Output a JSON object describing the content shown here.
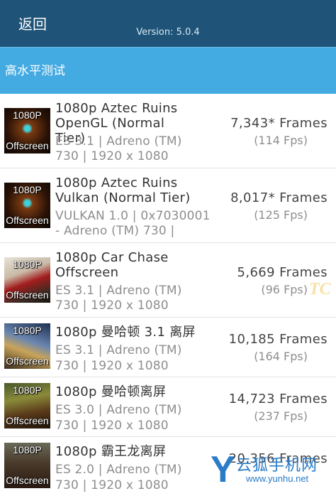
{
  "header": {
    "back_label": "返回",
    "version_text": "Version: 5.0.4",
    "bg_color": "#1f5478"
  },
  "section": {
    "title": "高水平测试",
    "bg_color": "#43aae2"
  },
  "tests": [
    {
      "thumb": {
        "top": "1080P",
        "bottom": "Offscreen",
        "scene": "aztec-opengl"
      },
      "name_l1": "1080p Aztec Ruins",
      "name_l2": "OpenGL (Normal Tier)",
      "sub_l1": "ES 3.1 | Adreno (TM)",
      "sub_l2": "730 | 1920 x 1080",
      "frames": "7,343* Frames",
      "fps": "(114 Fps)"
    },
    {
      "thumb": {
        "top": "1080P",
        "bottom": "Offscreen",
        "scene": "aztec-vulkan"
      },
      "name_l1": "1080p Aztec Ruins",
      "name_l2": "Vulkan (Normal Tier)",
      "sub_l1": "VULKAN 1.0 | 0x7030001",
      "sub_l2": "- Adreno (TM) 730 |",
      "frames": "8,017* Frames",
      "fps": "(125 Fps)"
    },
    {
      "thumb": {
        "top": "1080P",
        "bottom": "Offscreen",
        "scene": "car-chase"
      },
      "name_l1": "1080p Car Chase",
      "name_l2": "Offscreen",
      "sub_l1": "ES 3.1 | Adreno (TM)",
      "sub_l2": "730 | 1920 x 1080",
      "frames": "5,669 Frames",
      "fps": "(96 Fps)"
    },
    {
      "thumb": {
        "top": "1080P",
        "bottom": "Offscreen",
        "scene": "manhattan31"
      },
      "name_l1": "1080p 曼哈顿 3.1 离屏",
      "name_l2": "",
      "sub_l1": "ES 3.1 | Adreno (TM)",
      "sub_l2": "730 | 1920 x 1080",
      "frames": "10,185 Frames",
      "fps": "(164 Fps)"
    },
    {
      "thumb": {
        "top": "1080P",
        "bottom": "Offscreen",
        "scene": "manhattan"
      },
      "name_l1": "1080p 曼哈顿离屏",
      "name_l2": "",
      "sub_l1": "ES 3.0 | Adreno (TM)",
      "sub_l2": "730 | 1920 x 1080",
      "frames": "14,723 Frames",
      "fps": "(237 Fps)"
    },
    {
      "thumb": {
        "top": "1080P",
        "bottom": "Offscreen",
        "scene": "trex"
      },
      "name_l1": "1080p 霸王龙离屏",
      "name_l2": "",
      "sub_l1": "ES 2.0 | Adreno (TM)",
      "sub_l2": "730 | 1920 x 1080",
      "frames": "20,356 Frames",
      "fps": ""
    }
  ],
  "watermarks": {
    "tc_mark": "TC",
    "yunhu_letter": "Y",
    "yunhu_cn": "云狐手机网",
    "yunhu_url": "www.yunhu.net"
  }
}
